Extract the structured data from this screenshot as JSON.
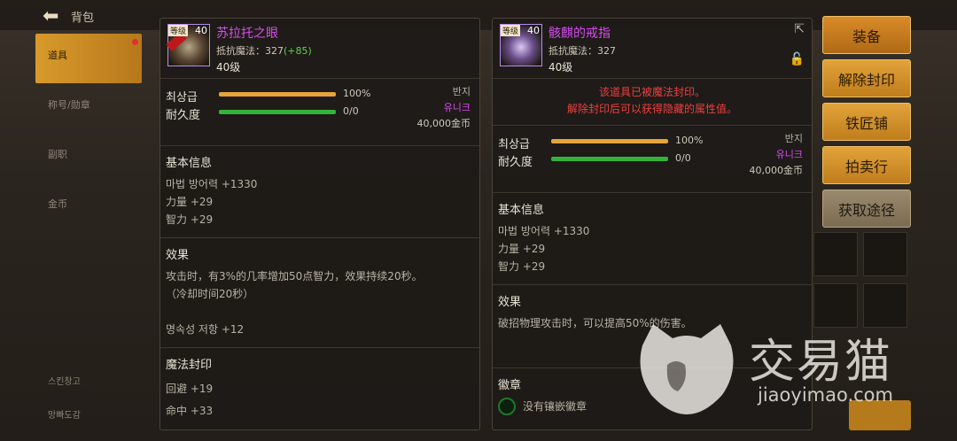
{
  "topbar": {
    "title": "背包"
  },
  "left_nav": {
    "items": [
      "道具",
      "称号/勋章",
      "副职",
      "金币"
    ],
    "bottom_items": [
      "스킨창고",
      "망빠도감"
    ]
  },
  "actions": [
    "装备",
    "解除封印",
    "铁匠铺",
    "拍卖行",
    "获取途径"
  ],
  "left_item": {
    "icon_tag": "等级",
    "icon_level": "40",
    "name": "苏拉托之眼",
    "stat": "抵抗魔法：327",
    "stat_bonus": "(+85)",
    "level": "40级",
    "bars": [
      {
        "label": "최상급",
        "value_text": "100%",
        "fraction": 1.0,
        "color": "#e5a53a"
      },
      {
        "label": "耐久度",
        "value_text": "0/0",
        "fraction": 1.0,
        "color": "#33b33a"
      }
    ],
    "type": "반지",
    "rarity": "유니크",
    "price": "40,000金币",
    "basic_title": "基本信息",
    "basic": [
      "마법 방어력 +1330",
      "力量 +29",
      "智力 +29"
    ],
    "effect_title": "效果",
    "effect": [
      "攻击时，有3%的几率增加50点智力，效果持续20秒。",
      "（冷却时间20秒）"
    ],
    "extra": "명속성 저항 +12",
    "seal_title": "魔法封印",
    "seal": [
      "回避 +19",
      "命中 +33"
    ]
  },
  "right_item": {
    "icon_tag": "等级",
    "icon_level": "40",
    "name": "骸麒的戒指",
    "stat": "抵抗魔法：327",
    "level": "40级",
    "sealed_notice": [
      "该道具已被魔法封印。",
      "解除封印后可以获得隐藏的属性值。"
    ],
    "bars": [
      {
        "label": "최상급",
        "value_text": "100%",
        "fraction": 1.0,
        "color": "#e5a53a"
      },
      {
        "label": "耐久度",
        "value_text": "0/0",
        "fraction": 1.0,
        "color": "#33b33a"
      }
    ],
    "type": "반지",
    "rarity": "유니크",
    "price": "40,000金币",
    "basic_title": "基本信息",
    "basic": [
      "마법 방어력 +1330",
      "力量 +29",
      "智力 +29"
    ],
    "effect_title": "效果",
    "effect": [
      "破招物理攻击时，可以提高50%的伤害。"
    ],
    "emblem_title": "徽章",
    "emblem": "没有镶嵌徽章"
  },
  "watermark": {
    "text": "交易猫",
    "url": "jiaoyimao.com"
  }
}
